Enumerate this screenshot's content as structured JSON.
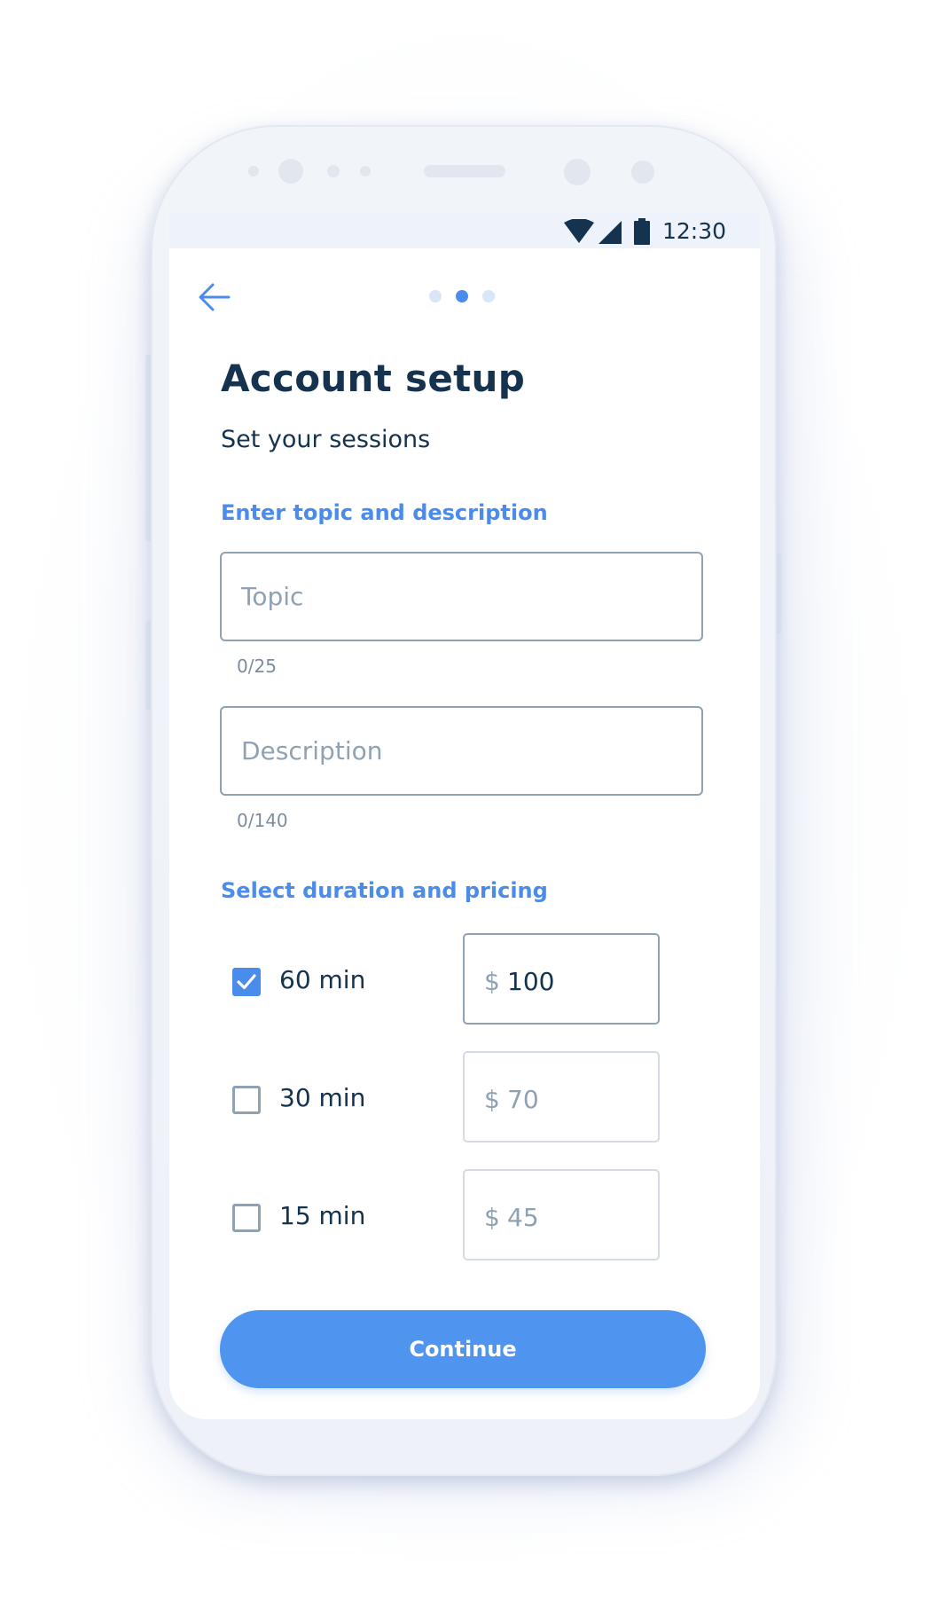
{
  "status_bar": {
    "time": "12:30",
    "icons": [
      "wifi-icon",
      "cellular-signal-icon",
      "battery-icon"
    ]
  },
  "header": {
    "back_icon": "arrow-left-icon",
    "steps_total": 3,
    "step_active": 2
  },
  "page": {
    "title": "Account setup",
    "subtitle": "Set your sessions"
  },
  "topic_section": {
    "label": "Enter topic and description",
    "topic": {
      "value": "",
      "placeholder": "Topic",
      "counter": "0/25"
    },
    "description": {
      "value": "",
      "placeholder": "Description",
      "counter": "0/140"
    }
  },
  "pricing_section": {
    "label": "Select duration and pricing",
    "options": [
      {
        "duration": "60 min",
        "checked": true,
        "currency": "$",
        "price": "100"
      },
      {
        "duration": "30 min",
        "checked": false,
        "currency": "$",
        "price": "70"
      },
      {
        "duration": "15 min",
        "checked": false,
        "currency": "$",
        "price": "45"
      }
    ]
  },
  "actions": {
    "continue_label": "Continue"
  },
  "colors": {
    "primary": "#4f94ee",
    "text_dark": "#15324f",
    "muted": "#8fa2b4",
    "background": "#ffffff"
  }
}
